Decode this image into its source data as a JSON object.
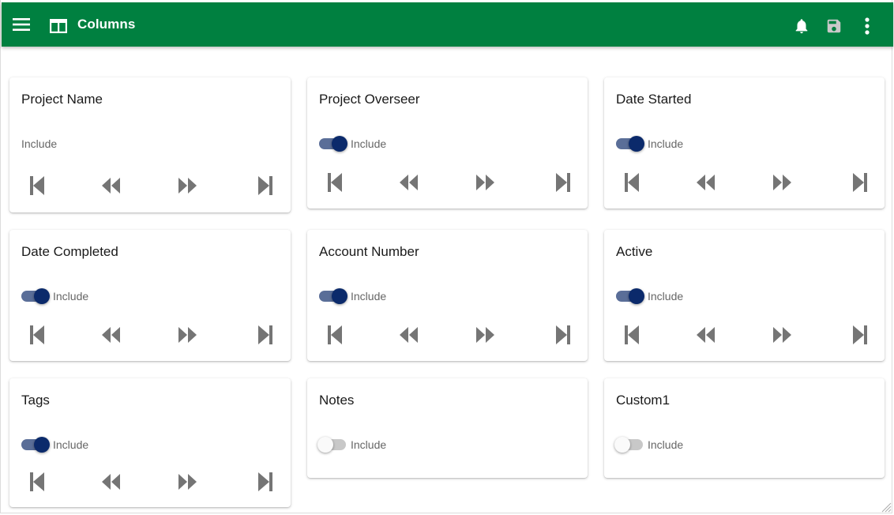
{
  "appbar": {
    "title": "Columns",
    "icons": {
      "menu": "menu-icon",
      "columns": "view-column-icon",
      "notifications": "bell-icon",
      "save": "save-icon",
      "more": "more-vert-icon"
    },
    "save_disabled": true
  },
  "colors": {
    "appbar": "#008040",
    "toggle_on_thumb": "#0b2a6b",
    "toggle_on_track": "#5a6e98",
    "nav_icon": "#757575"
  },
  "toggle_label": "Include",
  "nav_buttons": [
    {
      "name": "move-first",
      "icon": "first-page-icon"
    },
    {
      "name": "move-left",
      "icon": "fast-rewind-icon"
    },
    {
      "name": "move-right",
      "icon": "fast-forward-icon"
    },
    {
      "name": "move-last",
      "icon": "last-page-icon"
    }
  ],
  "columns": [
    {
      "title": "Project Name",
      "include_label": "Include",
      "has_toggle": false,
      "included": true,
      "has_nav": true
    },
    {
      "title": "Project Overseer",
      "include_label": "Include",
      "has_toggle": true,
      "included": true,
      "has_nav": true
    },
    {
      "title": "Date Started",
      "include_label": "Include",
      "has_toggle": true,
      "included": true,
      "has_nav": true
    },
    {
      "title": "Date Completed",
      "include_label": "Include",
      "has_toggle": true,
      "included": true,
      "has_nav": true
    },
    {
      "title": "Account Number",
      "include_label": "Include",
      "has_toggle": true,
      "included": true,
      "has_nav": true
    },
    {
      "title": "Active",
      "include_label": "Include",
      "has_toggle": true,
      "included": true,
      "has_nav": true
    },
    {
      "title": "Tags",
      "include_label": "Include",
      "has_toggle": true,
      "included": true,
      "has_nav": true
    },
    {
      "title": "Notes",
      "include_label": "Include",
      "has_toggle": true,
      "included": false,
      "has_nav": false
    },
    {
      "title": "Custom1",
      "include_label": "Include",
      "has_toggle": true,
      "included": false,
      "has_nav": false
    }
  ]
}
